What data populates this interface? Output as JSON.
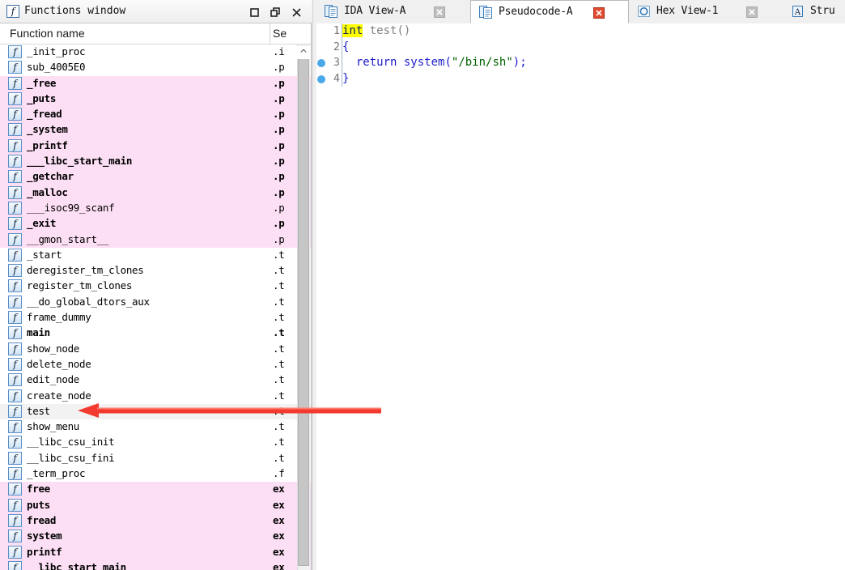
{
  "functions_window": {
    "title": "Functions window",
    "title_icon": "function-f-icon",
    "buttons": {
      "maximize": "maximize-icon",
      "restore": "restore-icon",
      "close": "close-icon"
    },
    "columns": {
      "name": "Function name",
      "segment": "Se"
    },
    "rows": [
      {
        "name": "_init_proc",
        "segment": ".i",
        "bold": false,
        "highlight": "none"
      },
      {
        "name": "sub_4005E0",
        "segment": ".p",
        "bold": false,
        "highlight": "none"
      },
      {
        "name": "_free",
        "segment": ".p",
        "bold": true,
        "highlight": "pink"
      },
      {
        "name": "_puts",
        "segment": ".p",
        "bold": true,
        "highlight": "pink"
      },
      {
        "name": "_fread",
        "segment": ".p",
        "bold": true,
        "highlight": "pink"
      },
      {
        "name": "_system",
        "segment": ".p",
        "bold": true,
        "highlight": "pink"
      },
      {
        "name": "_printf",
        "segment": ".p",
        "bold": true,
        "highlight": "pink"
      },
      {
        "name": "___libc_start_main",
        "segment": ".p",
        "bold": true,
        "highlight": "pink"
      },
      {
        "name": "_getchar",
        "segment": ".p",
        "bold": true,
        "highlight": "pink"
      },
      {
        "name": "_malloc",
        "segment": ".p",
        "bold": true,
        "highlight": "pink"
      },
      {
        "name": "___isoc99_scanf",
        "segment": ".p",
        "bold": false,
        "highlight": "pink"
      },
      {
        "name": "_exit",
        "segment": ".p",
        "bold": true,
        "highlight": "pink"
      },
      {
        "name": "__gmon_start__",
        "segment": ".p",
        "bold": false,
        "highlight": "pink"
      },
      {
        "name": "_start",
        "segment": ".t",
        "bold": false,
        "highlight": "none"
      },
      {
        "name": "deregister_tm_clones",
        "segment": ".t",
        "bold": false,
        "highlight": "none"
      },
      {
        "name": "register_tm_clones",
        "segment": ".t",
        "bold": false,
        "highlight": "none"
      },
      {
        "name": "__do_global_dtors_aux",
        "segment": ".t",
        "bold": false,
        "highlight": "none"
      },
      {
        "name": "frame_dummy",
        "segment": ".t",
        "bold": false,
        "highlight": "none"
      },
      {
        "name": "main",
        "segment": ".t",
        "bold": true,
        "highlight": "none"
      },
      {
        "name": "show_node",
        "segment": ".t",
        "bold": false,
        "highlight": "none"
      },
      {
        "name": "delete_node",
        "segment": ".t",
        "bold": false,
        "highlight": "none"
      },
      {
        "name": "edit_node",
        "segment": ".t",
        "bold": false,
        "highlight": "none"
      },
      {
        "name": "create_node",
        "segment": ".t",
        "bold": false,
        "highlight": "none"
      },
      {
        "name": "test",
        "segment": ".t",
        "bold": false,
        "highlight": "selected"
      },
      {
        "name": "show_menu",
        "segment": ".t",
        "bold": false,
        "highlight": "none"
      },
      {
        "name": "__libc_csu_init",
        "segment": ".t",
        "bold": false,
        "highlight": "none"
      },
      {
        "name": "__libc_csu_fini",
        "segment": ".t",
        "bold": false,
        "highlight": "none"
      },
      {
        "name": "_term_proc",
        "segment": ".f",
        "bold": false,
        "highlight": "none"
      },
      {
        "name": "free",
        "segment": "ex",
        "bold": true,
        "highlight": "pink"
      },
      {
        "name": "puts",
        "segment": "ex",
        "bold": true,
        "highlight": "pink"
      },
      {
        "name": "fread",
        "segment": "ex",
        "bold": true,
        "highlight": "pink"
      },
      {
        "name": "system",
        "segment": "ex",
        "bold": true,
        "highlight": "pink"
      },
      {
        "name": "printf",
        "segment": "ex",
        "bold": true,
        "highlight": "pink"
      },
      {
        "name": "__libc_start_main",
        "segment": "ex",
        "bold": true,
        "highlight": "pink"
      }
    ],
    "scrollbar": {
      "up_arrow": "chevron-up-icon"
    }
  },
  "editor": {
    "tabs": [
      {
        "label": "IDA View-A",
        "icon": "document-view-icon",
        "active": false,
        "close": "close-icon",
        "close_style": "gray"
      },
      {
        "label": "Pseudocode-A",
        "icon": "document-view-icon",
        "active": true,
        "close": "close-icon",
        "close_style": "red"
      },
      {
        "label": "Hex View-1",
        "icon": "hex-view-icon",
        "active": false,
        "close": "close-icon",
        "close_style": "gray"
      },
      {
        "label": "Stru",
        "icon": "structures-icon",
        "active": false,
        "close": "",
        "close_style": "none"
      }
    ],
    "code": {
      "lines": [
        {
          "number": "1",
          "bullet": false,
          "tokens": [
            {
              "text": "int",
              "style": "type-highlight"
            },
            {
              "text": " test()",
              "style": "gray"
            }
          ]
        },
        {
          "number": "2",
          "bullet": false,
          "tokens": [
            {
              "text": "{",
              "style": "punct"
            }
          ]
        },
        {
          "number": "3",
          "bullet": true,
          "tokens": [
            {
              "text": "  ",
              "style": "plain"
            },
            {
              "text": "return",
              "style": "keyword"
            },
            {
              "text": " ",
              "style": "plain"
            },
            {
              "text": "system",
              "style": "function"
            },
            {
              "text": "(",
              "style": "punct"
            },
            {
              "text": "\"/bin/sh\"",
              "style": "string"
            },
            {
              "text": ")",
              "style": "punct"
            },
            {
              "text": ";",
              "style": "punct"
            }
          ]
        },
        {
          "number": "4",
          "bullet": true,
          "tokens": [
            {
              "text": "}",
              "style": "punct"
            }
          ]
        }
      ]
    }
  },
  "annotation": {
    "arrow": "red-left-arrow",
    "color": "#f23a2e"
  },
  "colors": {
    "pink_row": "#fcdff4",
    "selected_row": "#f2f2f2",
    "keyword_blue": "#1a1acc",
    "string_green": "#006000",
    "type_highlight_bg": "#ffff00",
    "arrow_red": "#f23a2e",
    "bullet_blue": "#4aa8e8"
  }
}
